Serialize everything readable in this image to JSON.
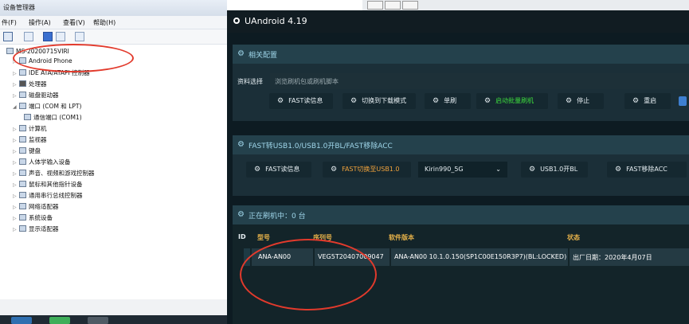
{
  "device_manager": {
    "title": "设备管理器",
    "menu": [
      "件(F)",
      "操作(A)",
      "查看(V)",
      "帮助(H)"
    ],
    "computer": "MS-20200715VIRI",
    "tree": [
      "Android Phone",
      "IDE ATA/ATAPI 控制器",
      "处理器",
      "磁盘驱动器",
      "端口 (COM 和 LPT)",
      "通信端口 (COM1)",
      "计算机",
      "监视器",
      "键盘",
      "人体学输入设备",
      "声音、视频和游戏控制器",
      "鼠标和其他指针设备",
      "通用串行总线控制器",
      "网络适配器",
      "系统设备",
      "显示适配器"
    ]
  },
  "app": {
    "title": "UAndroid 4.19",
    "panel1": {
      "title": "相关配置",
      "file_label": "资料选择",
      "file_placeholder": "浏览刷机包或刷机脚本",
      "buttons": [
        "FAST读信息",
        "切换到下载模式",
        "单刷",
        "启动批量刷机",
        "停止",
        "重启"
      ]
    },
    "panel2": {
      "title": "FAST转USB1.0/USB1.0开BL/FAST移除ACC",
      "buttons": [
        "FAST读信息",
        "FAST切换至USB1.0",
        "USB1.0开BL",
        "FAST移除ACC"
      ],
      "chip_select": "Kirin990_5G"
    },
    "panel3": {
      "title": "正在刷机中：0 台",
      "columns": [
        "ID",
        "型号",
        "序列号",
        "软件版本",
        "状态"
      ],
      "rows": [
        {
          "id": "",
          "model": "ANA-AN00",
          "serial": "VEG5T20407009047",
          "software": "ANA-AN00 10.1.0.150(SP1C00E150R3P7)(BL:LOCKED)",
          "status": "出厂日期：2020年4月07日"
        }
      ]
    }
  },
  "colors": {
    "accent_green": "#3ddc3d",
    "accent_orange": "#f0a23c",
    "header_gold": "#e8b34a",
    "annotation_red": "#e23a2c"
  }
}
